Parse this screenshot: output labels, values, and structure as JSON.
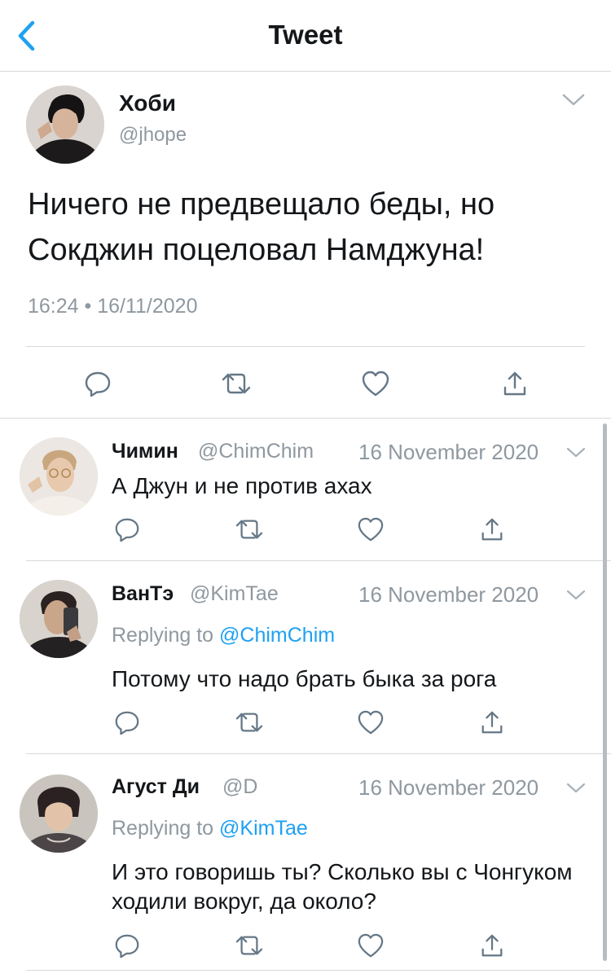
{
  "header": {
    "title": "Tweet",
    "back_icon": "chevron-left-icon",
    "accent": "#1da1f2"
  },
  "main_tweet": {
    "author_name": "Хоби",
    "author_handle": "@jhope",
    "text": "Ничего не предвещало беды, но Сокджин поцеловал Намджуна!",
    "timestamp": "16:24 • 16/11/2020",
    "actions": [
      "reply-icon",
      "retweet-icon",
      "like-icon",
      "share-icon"
    ]
  },
  "replies": [
    {
      "author_name": "Чимин",
      "author_handle": "@ChimChim",
      "date": "16 November 2020",
      "replying_prefix": "",
      "replying_to": "",
      "text": "А Джун и не против ахах"
    },
    {
      "author_name": "ВанТэ",
      "author_handle": "@KimTae",
      "date": "16 November 2020",
      "replying_prefix": "Replying to",
      "replying_to": "@ChimChim",
      "text": "Потому что надо брать быка за рога"
    },
    {
      "author_name": "Агуст Ди",
      "author_handle": "@D",
      "date": "16 November 2020",
      "replying_prefix": "Replying to",
      "replying_to": "@KimTae",
      "text": "И это говоришь ты? Сколько вы с Чонгуком ходили вокруг, да около?"
    }
  ],
  "colors": {
    "text": "#14171a",
    "secondary": "#8f989f",
    "link": "#1da1f2",
    "divider": "#d6d9dc"
  }
}
